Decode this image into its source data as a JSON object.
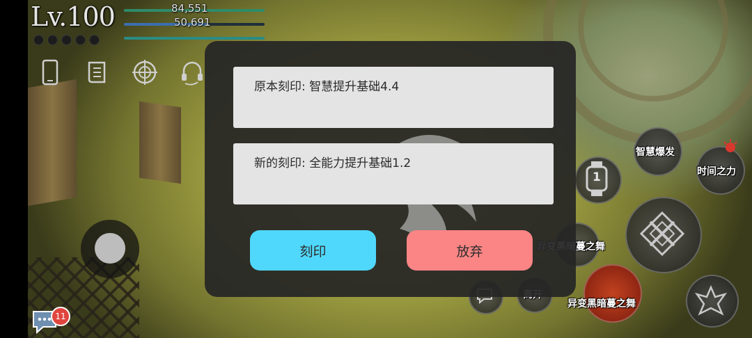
{
  "hud": {
    "level": "Lv.100",
    "hp_value": "84,551",
    "mp_value": "50,691"
  },
  "hud_icons": [
    "phone-icon",
    "scroll-icon",
    "compass-icon",
    "headset-icon"
  ],
  "dialog": {
    "original_label": "原本刻印: 智慧提升基础4.4",
    "new_label": "新的刻印: 全能力提升基础1.2",
    "engrave_button": "刻印",
    "discard_button": "放弃"
  },
  "skills": {
    "wisdom_burst": "智慧爆发",
    "power_of_time": "时间之力",
    "dark_vine_dance_1": "异变黑暗蔓之舞",
    "dark_vine_dance_2": "异变黑暗蔓之舞",
    "leave": "离开",
    "slot_number": "1"
  },
  "chat": {
    "unread_count": "11"
  },
  "colors": {
    "engrave_button": "#4fd8fb",
    "discard_button": "#fb8585",
    "hp_bar": "#2e8b6a",
    "mp_bar": "#3a6fb0",
    "dialog_bg": "#262626"
  }
}
